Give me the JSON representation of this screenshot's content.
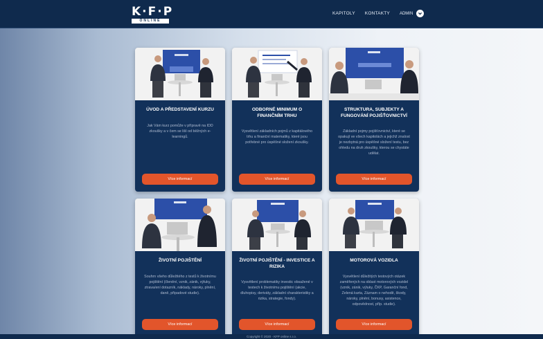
{
  "header": {
    "logo_main": "K·F·P",
    "logo_sub": "ONLINE",
    "nav": [
      "KAPITOLY",
      "KONTAKTY"
    ],
    "user": "ADMIN"
  },
  "cards": [
    {
      "title": "ÚVOD A PŘEDSTAVENÍ KURZU",
      "text": "Jak Vám kurz pomůže v přípravě na IDD zkoušky a v čem se liší od běžných e-learningů.",
      "button": "Více informací"
    },
    {
      "title": "ODBORNÉ MINIMUM O FINANČNÍM TRHU",
      "text": "Vysvětlení základních pojmů z kapitálového trhu a finanční matematiky, které jsou potřebné pro úspěšné složení zkoušky.",
      "button": "Více informací"
    },
    {
      "title": "STRUKTURA, SUBJEKTY A FUNGOVÁNÍ POJIŠŤOVNICTVÍ",
      "text": "Základní pojmy pojišťovnictví, které se opakují ve všech kapitolách a jejichž znalost je nezbytná pro úspěšné složení testu, bez ohledu na druh zkoušky, kterou se chystáte udělat.",
      "button": "Více informací"
    },
    {
      "title": "ŽIVOTNÍ POJIŠTĚNÍ",
      "text": "Souhrn všeho důležitého z testů k životnímu pojištění (členění, vznik, zánik, výluky, ztrava/ení dotazník, náklady, nároky, plnění, daně, připadové studie).",
      "button": "Více informací"
    },
    {
      "title": "ŽIVOTNÍ POJIŠTĚNÍ - INVESTICE A RIZIKA",
      "text": "Vysvětlení problematiky investic obsažené v testech k životnímu pojištění (akcie, dluhopisy, deriváty, základní charakteristiky a rizika, strategie, fondy).",
      "button": "Více informací"
    },
    {
      "title": "MOTOROVÁ VOZIDLA",
      "text": "Vysvětlení důležitých testových otázek zaměřených na oblast motorových vozidel (vznik, zánik, výluky, ČKP, Garanční fond, Zelená karta, Záznam o nehodě, škody, nároky, plnění, bonusy, asistence, odpovědnost, příp. studie).",
      "button": "Více informací"
    }
  ],
  "footer": {
    "copyright": "Copyright © 2020 - KFP online s.r.o."
  },
  "colors": {
    "header_bg": "#0f2a4d",
    "card_bg": "#12315a",
    "button_bg": "#e2552b",
    "screen_blue": "#2c4fa8"
  }
}
